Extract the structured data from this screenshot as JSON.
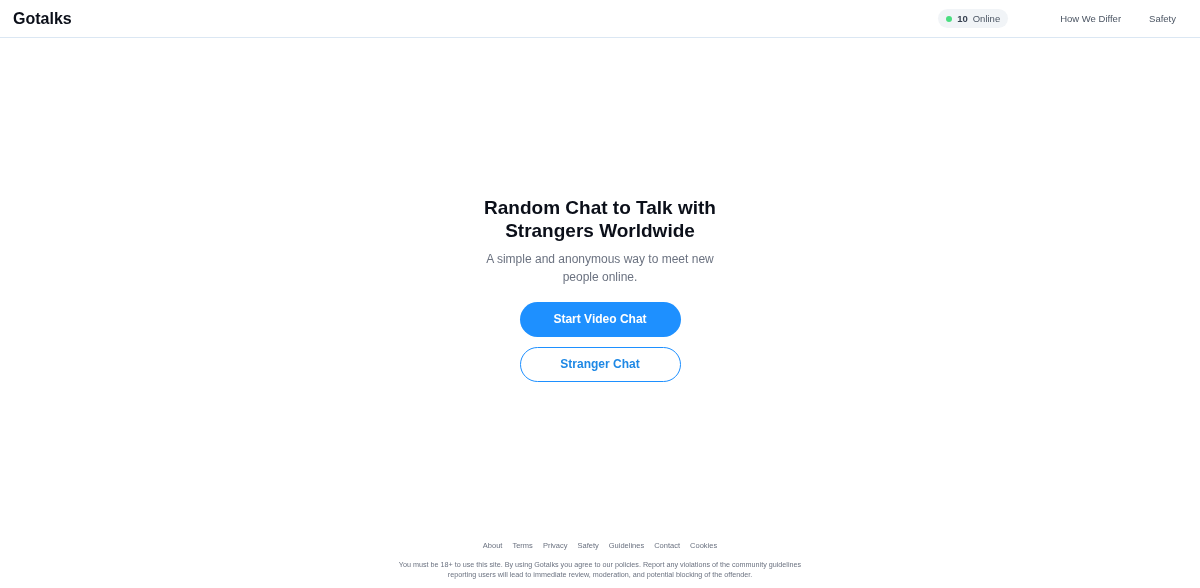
{
  "header": {
    "logo": "Gotalks",
    "online": {
      "count": "10",
      "label": "Online",
      "live": true
    },
    "nav": [
      "How We Differ",
      "Safety"
    ]
  },
  "hero": {
    "title": "Random Chat to Talk with Strangers Worldwide",
    "subtitle": "A simple and anonymous way to meet new people online.",
    "buttons": [
      {
        "label": "Start Video Chat",
        "kind": "primary"
      },
      {
        "label": "Stranger Chat",
        "kind": "outline"
      }
    ]
  },
  "footer": {
    "links": [
      "About",
      "Terms",
      "Privacy",
      "Safety",
      "Guidelines",
      "Contact",
      "Cookies"
    ],
    "notice": "You must be 18+ to use this site. By using Gotalks you agree to our policies. Report any violations of the community guidelines reporting users will lead to immediate review, moderation, and potential blocking of the offender."
  }
}
